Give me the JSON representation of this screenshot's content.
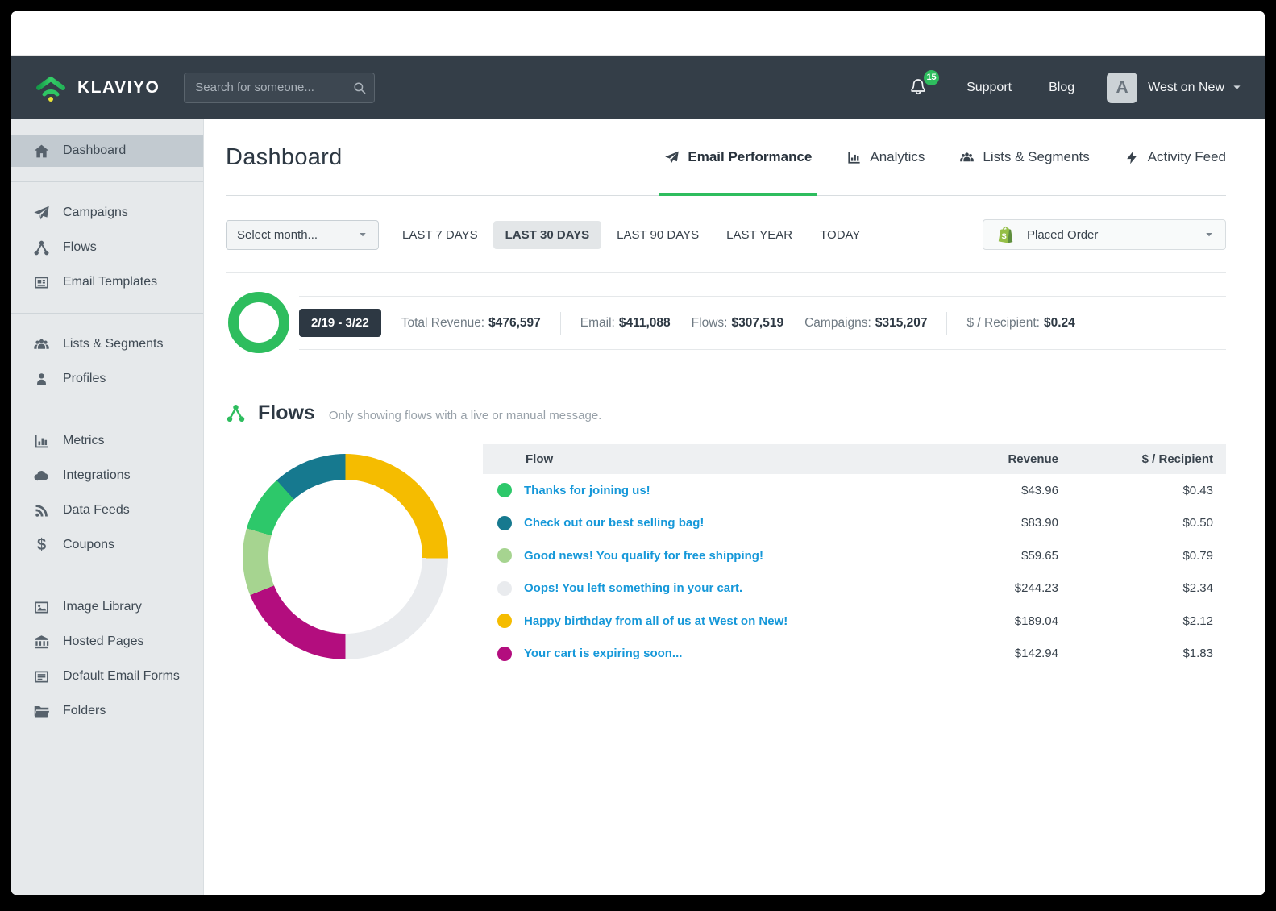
{
  "topnav": {
    "brand": "KLAVIYO",
    "search_placeholder": "Search for someone...",
    "notification_count": "15",
    "support_label": "Support",
    "blog_label": "Blog",
    "account_initial": "A",
    "account_name": "West on New"
  },
  "sidebar": {
    "groups": [
      {
        "items": [
          {
            "label": "Dashboard",
            "icon": "home-icon",
            "active": true
          }
        ]
      },
      {
        "items": [
          {
            "label": "Campaigns",
            "icon": "paper-plane-icon"
          },
          {
            "label": "Flows",
            "icon": "flow-icon"
          },
          {
            "label": "Email Templates",
            "icon": "template-icon"
          }
        ]
      },
      {
        "items": [
          {
            "label": "Lists & Segments",
            "icon": "people-icon"
          },
          {
            "label": "Profiles",
            "icon": "person-icon"
          }
        ]
      },
      {
        "items": [
          {
            "label": "Metrics",
            "icon": "bar-chart-icon"
          },
          {
            "label": "Integrations",
            "icon": "cloud-icon"
          },
          {
            "label": "Data Feeds",
            "icon": "rss-icon"
          },
          {
            "label": "Coupons",
            "icon": "dollar-icon"
          }
        ]
      },
      {
        "items": [
          {
            "label": "Image Library",
            "icon": "image-icon"
          },
          {
            "label": "Hosted Pages",
            "icon": "bank-icon"
          },
          {
            "label": "Default Email Forms",
            "icon": "form-icon"
          },
          {
            "label": "Folders",
            "icon": "folder-icon"
          }
        ]
      }
    ]
  },
  "header": {
    "title": "Dashboard",
    "tabs": [
      {
        "label": "Email Performance",
        "icon": "paper-plane-icon",
        "active": true
      },
      {
        "label": "Analytics",
        "icon": "bar-chart-icon",
        "active": false
      },
      {
        "label": "Lists & Segments",
        "icon": "people-icon",
        "active": false
      },
      {
        "label": "Activity Feed",
        "icon": "lightning-icon",
        "active": false
      }
    ]
  },
  "filters": {
    "month_select": "Select month...",
    "ranges": [
      "LAST 7 DAYS",
      "LAST 30 DAYS",
      "LAST 90 DAYS",
      "LAST YEAR",
      "TODAY"
    ],
    "active_range": "LAST 30 DAYS",
    "metric_select": "Placed Order",
    "metric_icon": "shopify-icon"
  },
  "summary": {
    "date_range": "2/19 - 3/22",
    "ring_color": "#2ebd5e",
    "stat_groups": [
      [
        {
          "label": "Total Revenue:",
          "value": "$476,597"
        }
      ],
      [
        {
          "label": "Email:",
          "value": "$411,088"
        },
        {
          "label": "Flows:",
          "value": "$307,519"
        },
        {
          "label": "Campaigns:",
          "value": "$315,207"
        }
      ],
      [
        {
          "label": "$ / Recipient:",
          "value": "$0.24"
        }
      ]
    ]
  },
  "flows_section": {
    "title": "Flows",
    "subtitle": "Only showing flows with a live or manual message.",
    "table": {
      "columns": [
        "Flow",
        "Revenue",
        "$ / Recipient"
      ],
      "rows": [
        {
          "color": "#2dc86a",
          "label": "Thanks for joining us!",
          "revenue": "$43.96",
          "per_recipient": "$0.43"
        },
        {
          "color": "#16798f",
          "label": "Check out our best selling bag!",
          "revenue": "$83.90",
          "per_recipient": "$0.50"
        },
        {
          "color": "#a6d490",
          "label": "Good news! You qualify for free shipping!",
          "revenue": "$59.65",
          "per_recipient": "$0.79"
        },
        {
          "color": "#e9ebee",
          "label": "Oops! You left something in your cart.",
          "revenue": "$244.23",
          "per_recipient": "$2.34"
        },
        {
          "color": "#f5bc00",
          "label": "Happy birthday from all of us at West on New!",
          "revenue": "$189.04",
          "per_recipient": "$2.12"
        },
        {
          "color": "#b30d7e",
          "label": "Your cart is expiring soon...",
          "revenue": "$142.94",
          "per_recipient": "$1.83"
        }
      ]
    }
  },
  "chart_data": {
    "type": "pie",
    "variant": "donut",
    "title": "Flows revenue by flow",
    "legend_position": "none",
    "series": [
      {
        "name": "Thanks for joining us!",
        "revenue": 43.96,
        "per_recipient": 0.43,
        "color": "#2dc86a"
      },
      {
        "name": "Check out our best selling bag!",
        "revenue": 83.9,
        "per_recipient": 0.5,
        "color": "#16798f"
      },
      {
        "name": "Good news! You qualify for free shipping!",
        "revenue": 59.65,
        "per_recipient": 0.79,
        "color": "#a6d490"
      },
      {
        "name": "Oops! You left something in your cart.",
        "revenue": 244.23,
        "per_recipient": 2.34,
        "color": "#e9ebee"
      },
      {
        "name": "Happy birthday from all of us at West on New!",
        "revenue": 189.04,
        "per_recipient": 2.12,
        "color": "#f5bc00"
      },
      {
        "name": "Your cart is expiring soon...",
        "revenue": 142.94,
        "per_recipient": 1.83,
        "color": "#b30d7e"
      }
    ],
    "segments_clockwise_from_top": [
      {
        "label": "Happy birthday from all of us at West on New!",
        "color": "#f5bc00",
        "start_deg": 0,
        "end_deg": 91
      },
      {
        "label": "Oops! You left something in your cart.",
        "color": "#e9ebee",
        "start_deg": 91,
        "end_deg": 180
      },
      {
        "label": "Your cart is expiring soon...",
        "color": "#b30d7e",
        "start_deg": 180,
        "end_deg": 248
      },
      {
        "label": "Good news! You qualify for free shipping!",
        "color": "#a6d490",
        "start_deg": 248,
        "end_deg": 286
      },
      {
        "label": "Thanks for joining us!",
        "color": "#2dc86a",
        "start_deg": 286,
        "end_deg": 318
      },
      {
        "label": "Check out our best selling bag!",
        "color": "#16798f",
        "start_deg": 318,
        "end_deg": 360
      }
    ]
  }
}
